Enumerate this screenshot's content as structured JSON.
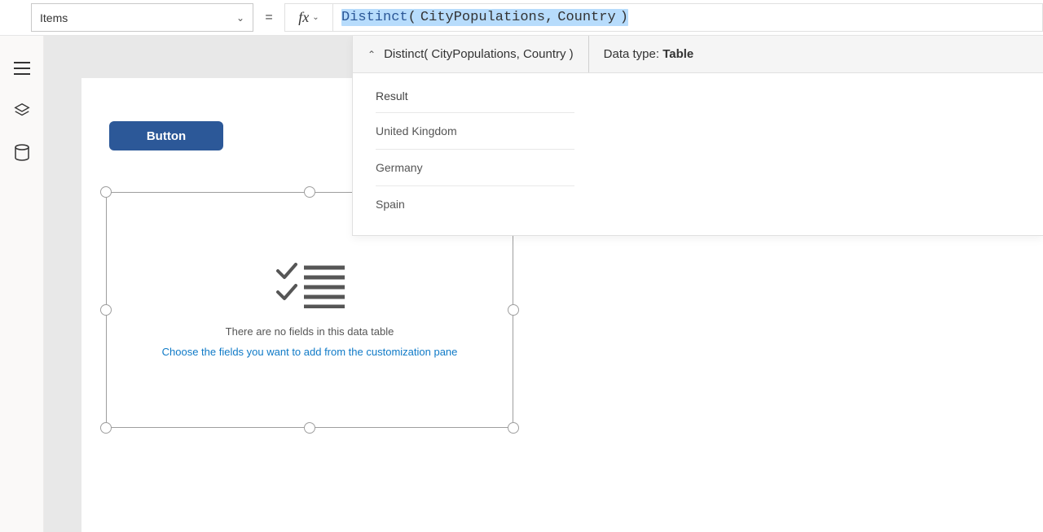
{
  "formula_bar": {
    "property": "Items",
    "equals": "=",
    "fx_label": "fx",
    "tokens": {
      "fn": "Distinct",
      "open": "(",
      "arg1": "CityPopulations",
      "comma": ",",
      "arg2": "Country",
      "close": ")"
    }
  },
  "intellisense": {
    "signature": "Distinct( CityPopulations, Country )",
    "datatype_label": "Data type: ",
    "datatype_value": "Table",
    "result_header": "Result",
    "rows": [
      "United Kingdom",
      "Germany",
      "Spain"
    ]
  },
  "canvas": {
    "button_label": "Button",
    "datatable": {
      "line1": "There are no fields in this data table",
      "line2": "Choose the fields you want to add from the customization pane"
    }
  },
  "rail": {
    "tree": "tree-view-icon",
    "layers": "layers-icon",
    "data": "data-icon"
  }
}
